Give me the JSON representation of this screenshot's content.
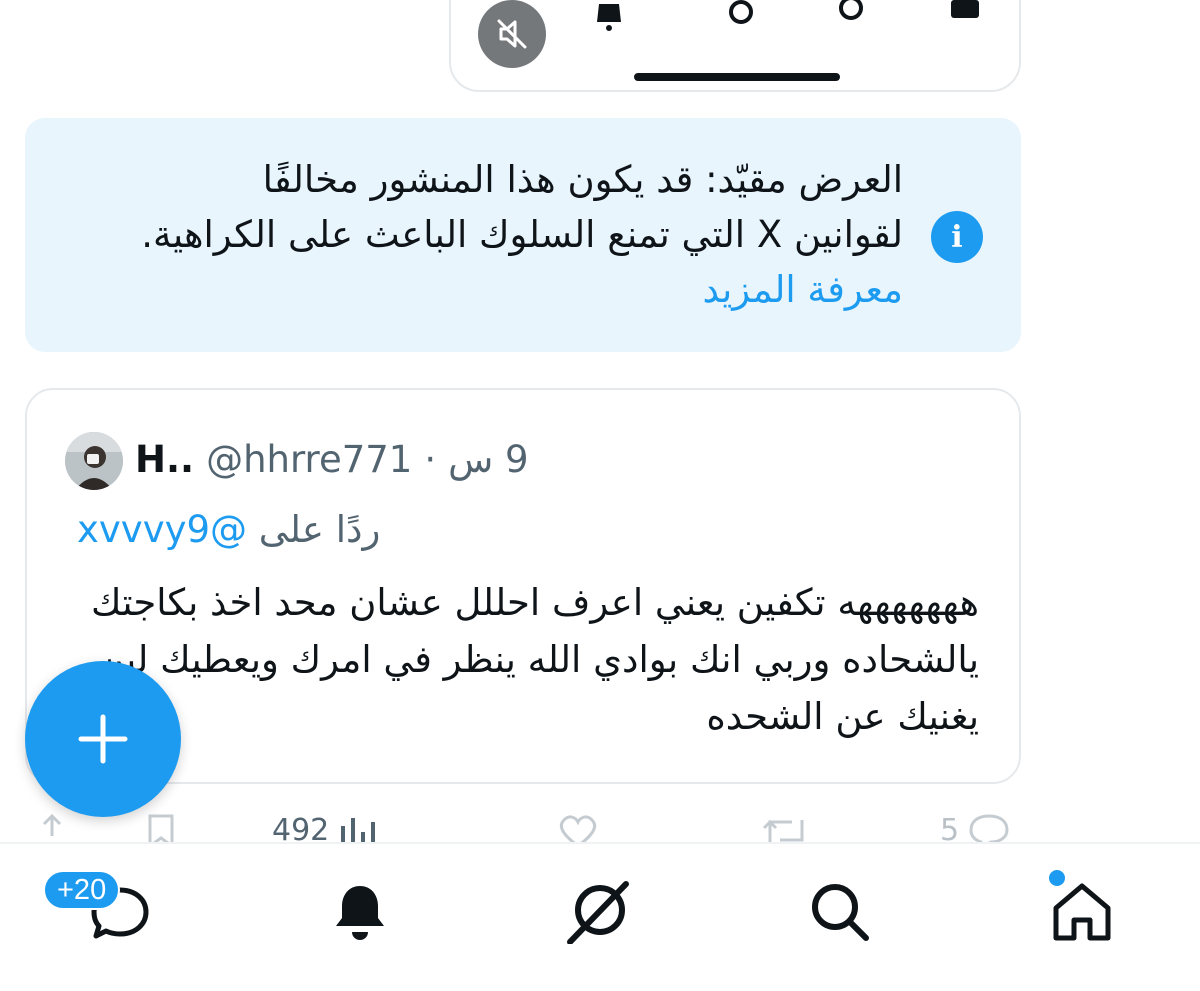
{
  "notice": {
    "line1": "العرض مقيّد: قد يكون هذا المنشور مخالفًا",
    "line2": "لقوانين X التي تمنع السلوك الباعث على الكراهية.",
    "link": "معرفة المزيد",
    "icon": "info-icon"
  },
  "tweet": {
    "author_name": "H..",
    "handle": "@hhrre771",
    "separator": "·",
    "time": "9 س",
    "reply_prefix": "ردًا على",
    "reply_handle": "@xvvvy9",
    "text": "هههههههه تكفين يعني اعرف احللل عشان محد اخذ بكاجتك يالشحاده وربي انك بوادي الله ينظر في امرك ويعطيك لين يغنيك عن الشحده"
  },
  "actions": {
    "views": "492",
    "replies": "5"
  },
  "nav": {
    "messages_badge": "+20",
    "items": [
      "messages-icon",
      "notifications-icon",
      "grok-icon",
      "search-icon",
      "home-icon"
    ]
  },
  "colors": {
    "accent": "#1d9bf0",
    "notice_bg": "#e8f5fd",
    "text": "#0f1419",
    "secondary": "#536471"
  }
}
